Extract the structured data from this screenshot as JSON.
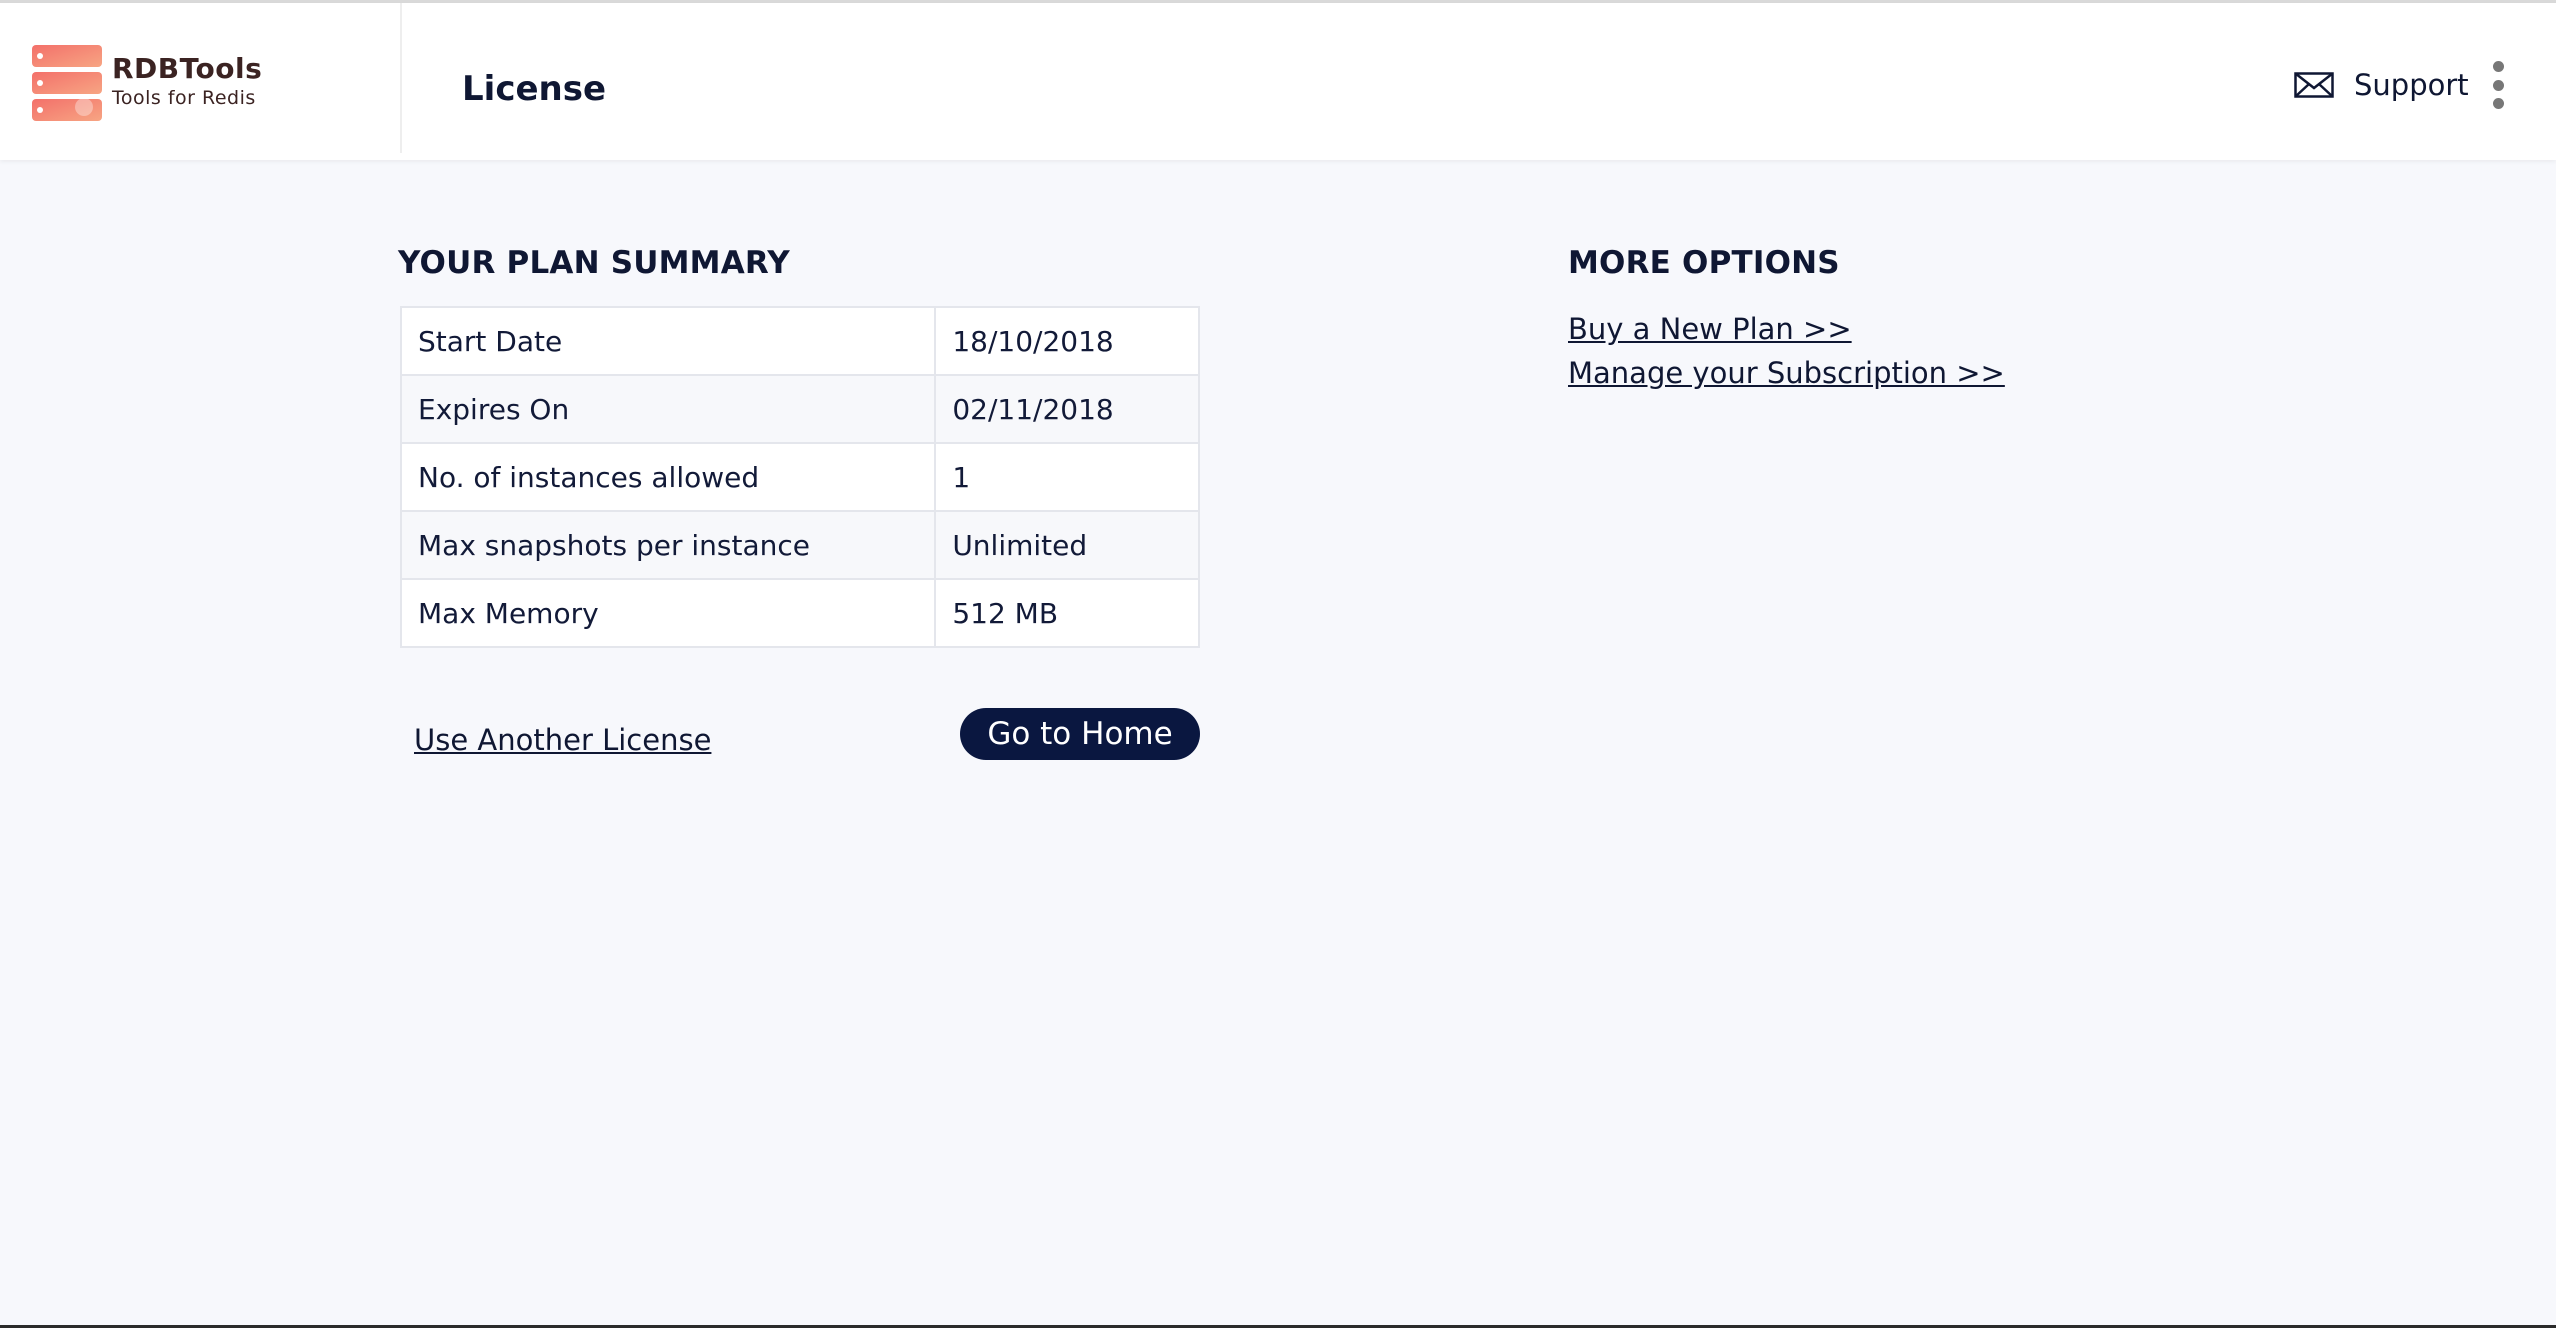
{
  "brand": {
    "name": "RDBTools",
    "tagline": "Tools for Redis"
  },
  "header": {
    "title": "License",
    "support_label": "Support"
  },
  "plan_summary": {
    "title": "YOUR PLAN SUMMARY",
    "rows": [
      {
        "label": "Start Date",
        "value": "18/10/2018"
      },
      {
        "label": "Expires On",
        "value": "02/11/2018"
      },
      {
        "label": "No. of instances allowed",
        "value": "1"
      },
      {
        "label": "Max snapshots per instance",
        "value": "Unlimited"
      },
      {
        "label": "Max Memory",
        "value": "512 MB"
      }
    ],
    "use_another_license": "Use Another License",
    "go_home": "Go to Home"
  },
  "more_options": {
    "title": "MORE OPTIONS",
    "buy_new_plan": "Buy a New Plan >>",
    "manage_subscription": "Manage your Subscription >>"
  },
  "colors": {
    "accent_dark": "#0a1740",
    "logo_gradient_start": "#f3706a",
    "logo_gradient_end": "#f6a07f"
  },
  "icons": {
    "logo": "server-stack-icon",
    "support": "envelope-icon",
    "menu": "kebab-menu-icon"
  }
}
